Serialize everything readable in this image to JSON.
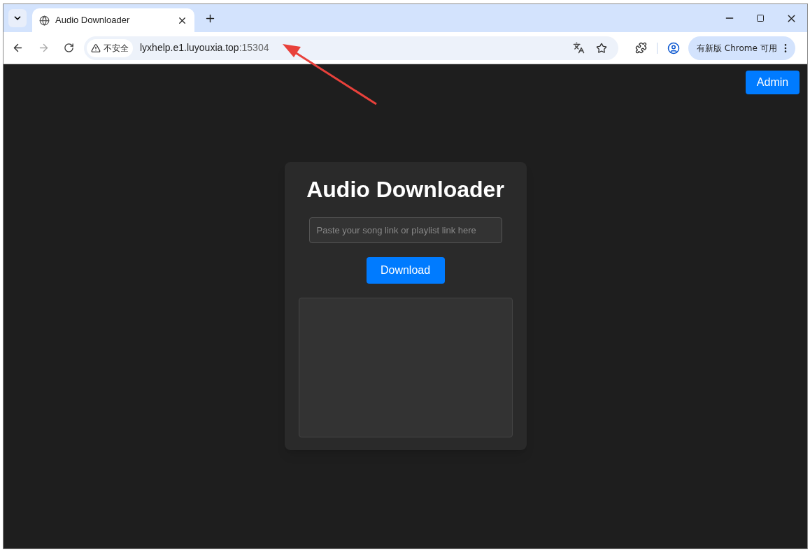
{
  "browser": {
    "tabs": [
      {
        "title": "Audio Downloader",
        "selected": true
      }
    ],
    "security_label": "不安全",
    "url_host": "lyxhelp.e1.luyouxia.top",
    "url_port": ":15304",
    "update_label": "有新版 Chrome 可用"
  },
  "page": {
    "admin_button": "Admin",
    "title": "Audio Downloader",
    "link_field": {
      "placeholder": "Paste your song link or playlist link here"
    },
    "download_button": "Download"
  }
}
